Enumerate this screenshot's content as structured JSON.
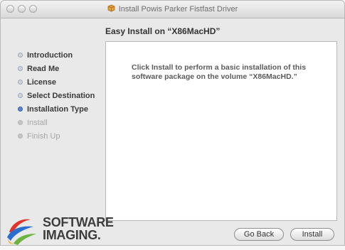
{
  "window": {
    "title": "Install Powis Parker Fistfast Driver"
  },
  "pane": {
    "header": "Easy Install on “X86MacHD”",
    "message": "Click Install to perform a basic installation of this software package on the volume “X86MacHD.”"
  },
  "sidebar": {
    "steps": [
      {
        "label": "Introduction",
        "state": "done"
      },
      {
        "label": "Read Me",
        "state": "done"
      },
      {
        "label": "License",
        "state": "done"
      },
      {
        "label": "Select Destination",
        "state": "done"
      },
      {
        "label": "Installation Type",
        "state": "current"
      },
      {
        "label": "Install",
        "state": "pending"
      },
      {
        "label": "Finish Up",
        "state": "pending"
      }
    ]
  },
  "logo": {
    "line1": "SOFTWARE",
    "line2": "IMAGING."
  },
  "buttons": {
    "back": "Go Back",
    "install": "Install"
  },
  "colors": {
    "current_step": "#5b86cf",
    "logo_red": "#e2342b",
    "logo_blue": "#2a6fd0",
    "logo_green": "#6cb33f"
  }
}
